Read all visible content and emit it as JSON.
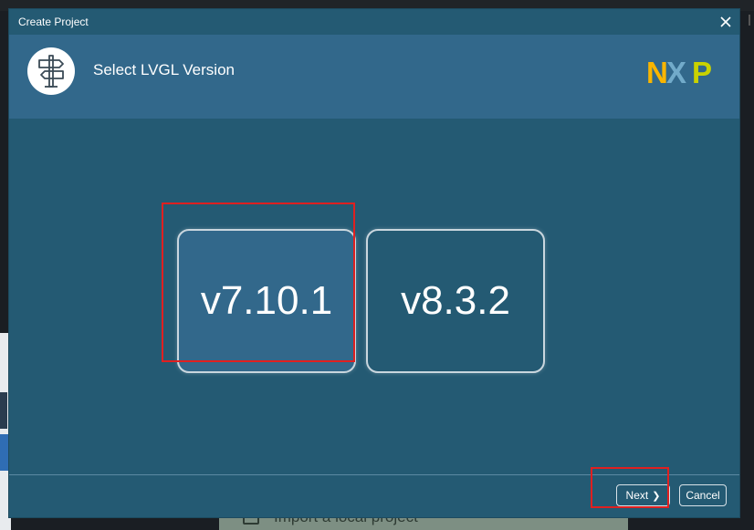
{
  "dialog": {
    "title": "Create Project",
    "heading": "Select LVGL Version",
    "brand": "NXP"
  },
  "versions": [
    {
      "label": "v7.10.1",
      "selected": true
    },
    {
      "label": "v8.3.2",
      "selected": false
    }
  ],
  "footer": {
    "next_label": "Next",
    "cancel_label": "Cancel"
  },
  "background": {
    "panel_text": "Import a local project"
  },
  "icons": {
    "header": "signpost-icon",
    "close": "close-icon",
    "next": "chevron-right-icon"
  },
  "colors": {
    "dialog_bg": "#245a73",
    "header_bg": "#32688b",
    "selected_tile": "#32688b",
    "highlight": "#e02020",
    "nxp_orange": "#f9b500",
    "nxp_blue": "#7ab3d1",
    "nxp_green": "#c9d200"
  }
}
